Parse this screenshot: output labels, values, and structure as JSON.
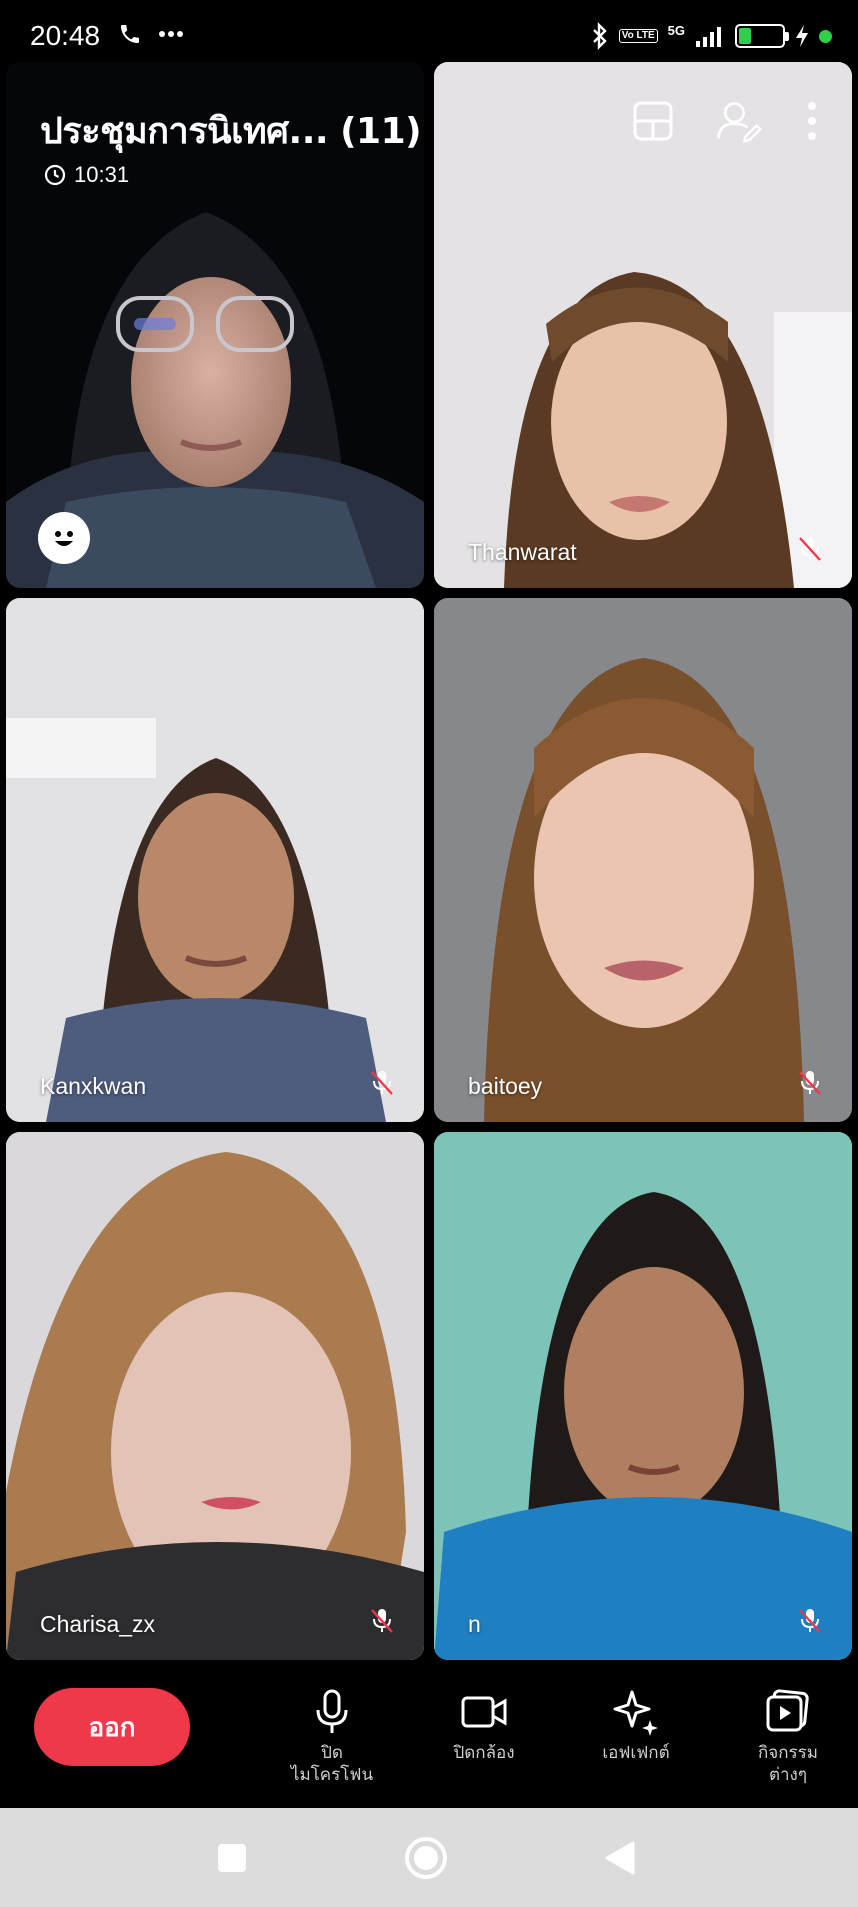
{
  "status_bar": {
    "time": "20:48",
    "lte_label": "Vo LTE",
    "network": "5G",
    "battery": "29",
    "battery_level": 0.29
  },
  "meeting": {
    "title": "ประชุมการนิเทศ... (11)",
    "timer": "10:31"
  },
  "participants": [
    {
      "name": ""
    },
    {
      "name": "Thanwarat"
    },
    {
      "name": "Kanxkwan"
    },
    {
      "name": "baitoey"
    },
    {
      "name": "Charisa_zx"
    },
    {
      "name": "n"
    }
  ],
  "controls": {
    "leave": "ออก",
    "mic_off": "ปิด\nไมโครโฟน",
    "camera_off": "ปิดกล้อง",
    "effects": "เอฟเฟกต์",
    "activities": "กิจกรรม\nต่างๆ"
  },
  "colors": {
    "leave_button": "#f0384b",
    "battery_fill": "#2fd14a",
    "nav_bar": "#dcdcdc"
  },
  "icons": {
    "top_actions": [
      "layout-icon",
      "add-participant-icon",
      "more-vert-icon"
    ],
    "nav": [
      "recents-square-icon",
      "home-circle-icon",
      "back-triangle-icon"
    ]
  }
}
